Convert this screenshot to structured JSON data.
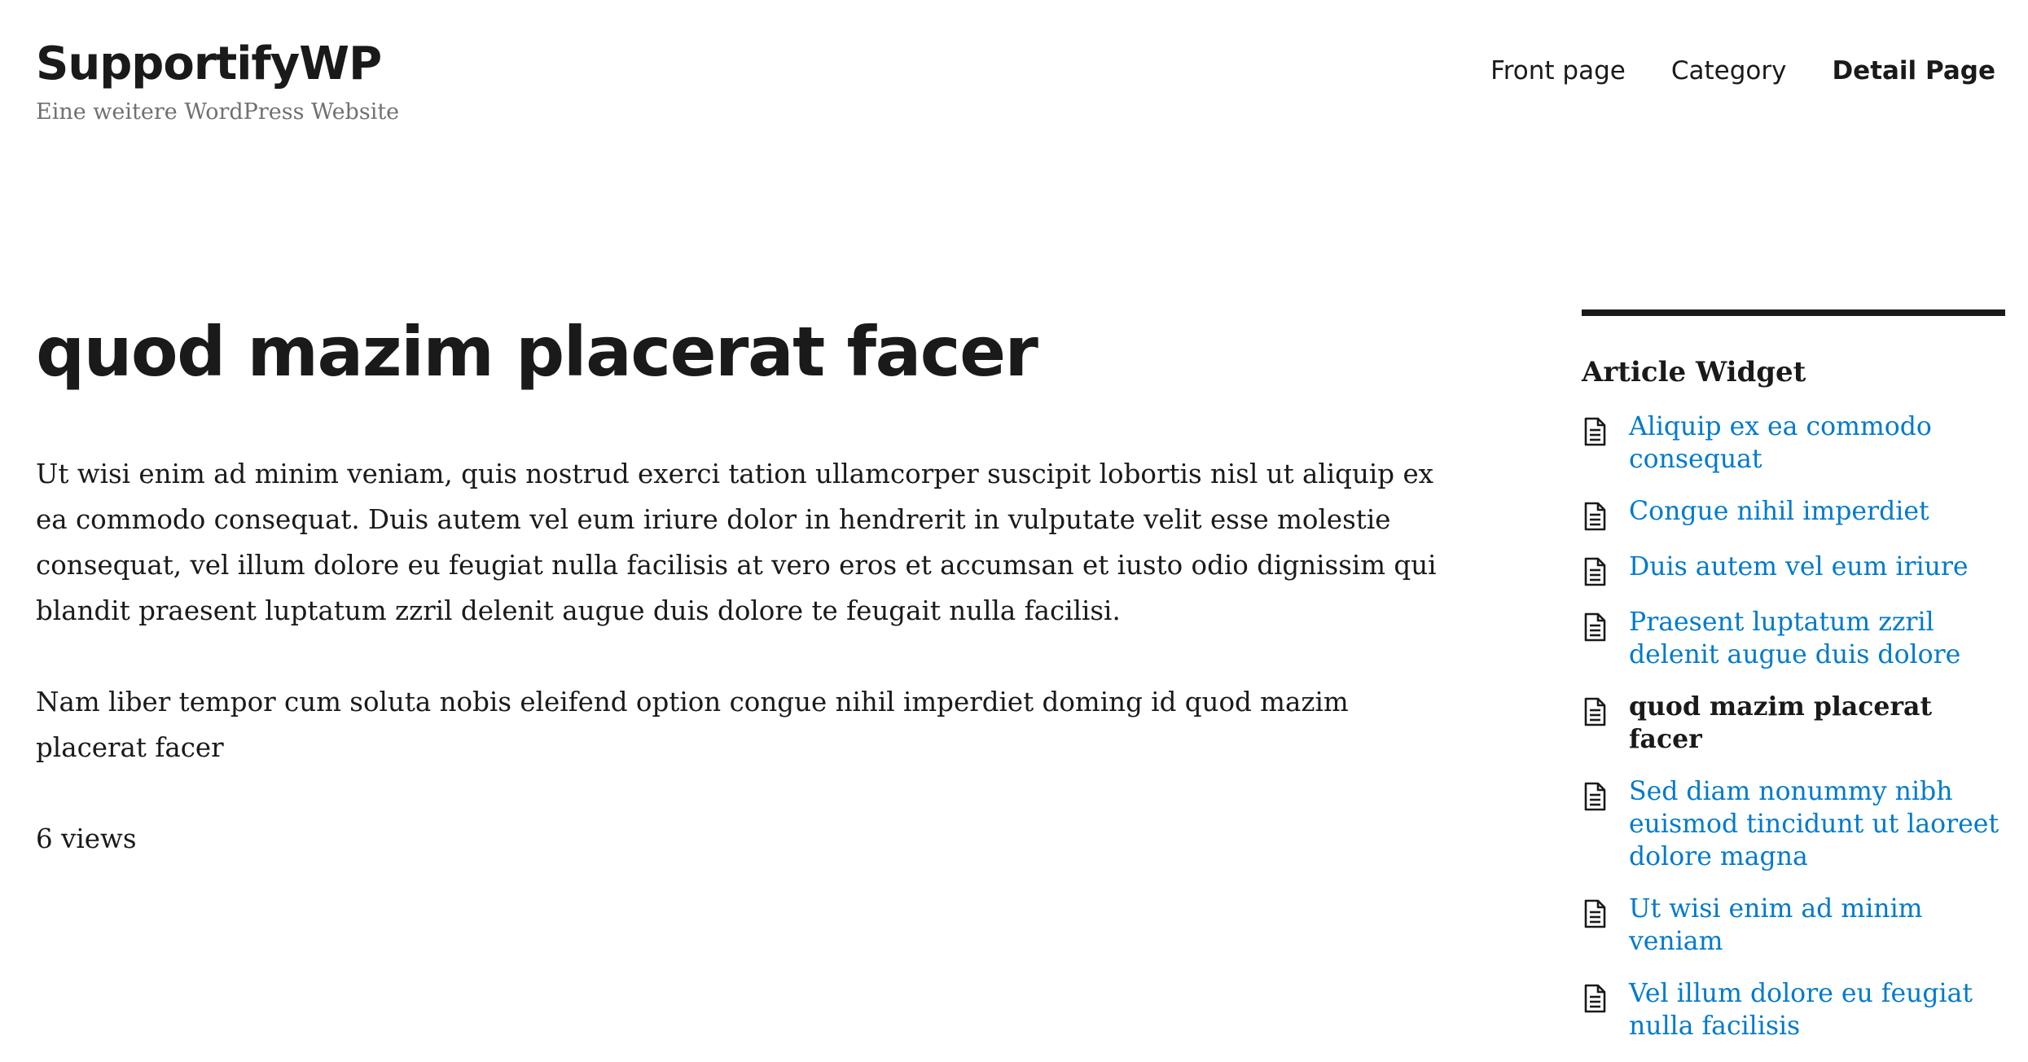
{
  "header": {
    "site_title": "SupportifyWP",
    "tagline": "Eine weitere WordPress Website"
  },
  "nav": {
    "items": [
      {
        "label": "Front page",
        "current": false
      },
      {
        "label": "Category",
        "current": false
      },
      {
        "label": "Detail Page",
        "current": true
      }
    ]
  },
  "article": {
    "title": "quod mazim placerat facer",
    "paragraphs": [
      "Ut wisi enim ad minim veniam, quis nostrud exerci tation ullamcorper suscipit lobortis nisl ut aliquip ex ea commodo consequat. Duis autem vel eum iriure dolor in hendrerit in vulputate velit esse molestie consequat, vel illum dolore eu feugiat nulla facilisis at vero eros et accumsan et iusto odio dignissim qui blandit praesent luptatum zzril delenit augue duis dolore te feugait nulla facilisi.",
      "Nam liber tempor cum soluta nobis eleifend option congue nihil imperdiet doming id quod mazim placerat facer"
    ],
    "views": "6 views"
  },
  "sidebar": {
    "widget_title": "Article Widget",
    "items": [
      {
        "label": "Aliquip ex ea commodo consequat",
        "icon": "document-icon",
        "current": false
      },
      {
        "label": "Congue nihil imperdiet",
        "icon": "document-icon",
        "current": false
      },
      {
        "label": "Duis autem vel eum iriure",
        "icon": "document-icon",
        "current": false
      },
      {
        "label": "Praesent luptatum zzril delenit augue duis dolore",
        "icon": "document-icon",
        "current": false
      },
      {
        "label": "quod mazim placerat facer",
        "icon": "document-icon",
        "current": true
      },
      {
        "label": "Sed diam nonummy nibh euismod tincidunt ut laoreet dolore magna",
        "icon": "document-icon",
        "current": false
      },
      {
        "label": "Ut wisi enim ad minim veniam",
        "icon": "document-icon",
        "current": false
      },
      {
        "label": "Vel illum dolore eu feugiat nulla facilisis",
        "icon": "document-icon",
        "current": false
      }
    ]
  },
  "colors": {
    "text": "#1a1a1a",
    "link": "#007acc",
    "tagline": "#707070",
    "background": "#ffffff"
  }
}
